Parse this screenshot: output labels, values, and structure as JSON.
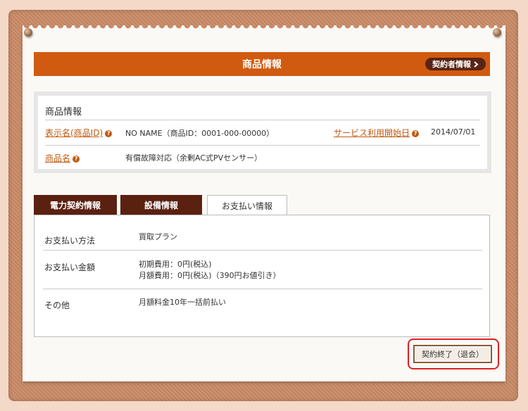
{
  "header": {
    "title": "商品情報",
    "contractor_button": "契約者情報"
  },
  "product": {
    "section_title": "商品情報",
    "display_name_label": "表示名(商品ID)",
    "display_name_value": "NO NAME（商品ID：0001-000-00000）",
    "service_start_label": "サービス利用開始日",
    "service_start_value": "2014/07/01",
    "product_name_label": "商品名",
    "product_name_value": "有償故障対応（余剰AC式PVセンサー）"
  },
  "tabs": [
    {
      "label": "電力契約情報",
      "active": false
    },
    {
      "label": "設備情報",
      "active": false
    },
    {
      "label": "お支払い情報",
      "active": true
    }
  ],
  "payment": {
    "method_label": "お支払い方法",
    "method_value": "買取プラン",
    "amount_label": "お支払い金額",
    "amount_initial": "初期費用：0円(税込)",
    "amount_monthly": "月額費用：0円(税込)（390円お値引き）",
    "other_label": "その他",
    "other_value": "月額料金10年一括前払い"
  },
  "actions": {
    "end_contract_button": "契約終了（退会）"
  },
  "icons": {
    "help": "question-icon",
    "chevron": "chevron-right-icon"
  },
  "colors": {
    "accent": "#d05a10",
    "tab_dark": "#5a2010",
    "link": "#c05a10",
    "highlight": "#e02020"
  }
}
